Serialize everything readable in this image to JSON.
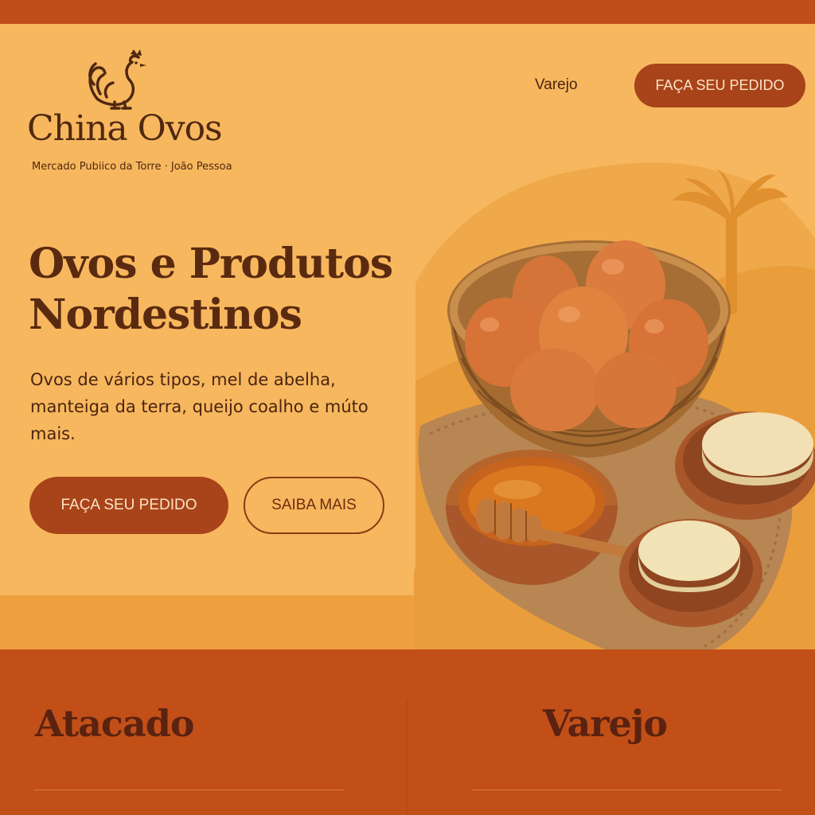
{
  "brand": {
    "name": "China Ovos",
    "subtitle": "Mercado Pubiico da Torre · João Pessoa"
  },
  "nav": {
    "link_label": "Varejo",
    "cta_label": "FAÇA SEU PEDIDO"
  },
  "hero": {
    "headline": "Ovos e Produtos Nordestinos",
    "lead": "Ovos de vários tipos, mel de abelha, manteiga da terra, queijo coalho e múto mais.",
    "primary_cta": "FAÇA SEU PEDIDO",
    "secondary_cta": "SAIBA MAIS"
  },
  "sections": {
    "left_title": "Atacado",
    "right_title": "Varejo"
  },
  "colors": {
    "brand_orange": "#C14E1A",
    "button_brown": "#A9431A",
    "text_dark": "#4F2810",
    "hero_bg": "#F7B75E"
  },
  "icons": {
    "logo": "rooster-icon",
    "decor": "palm-tree-icon"
  }
}
